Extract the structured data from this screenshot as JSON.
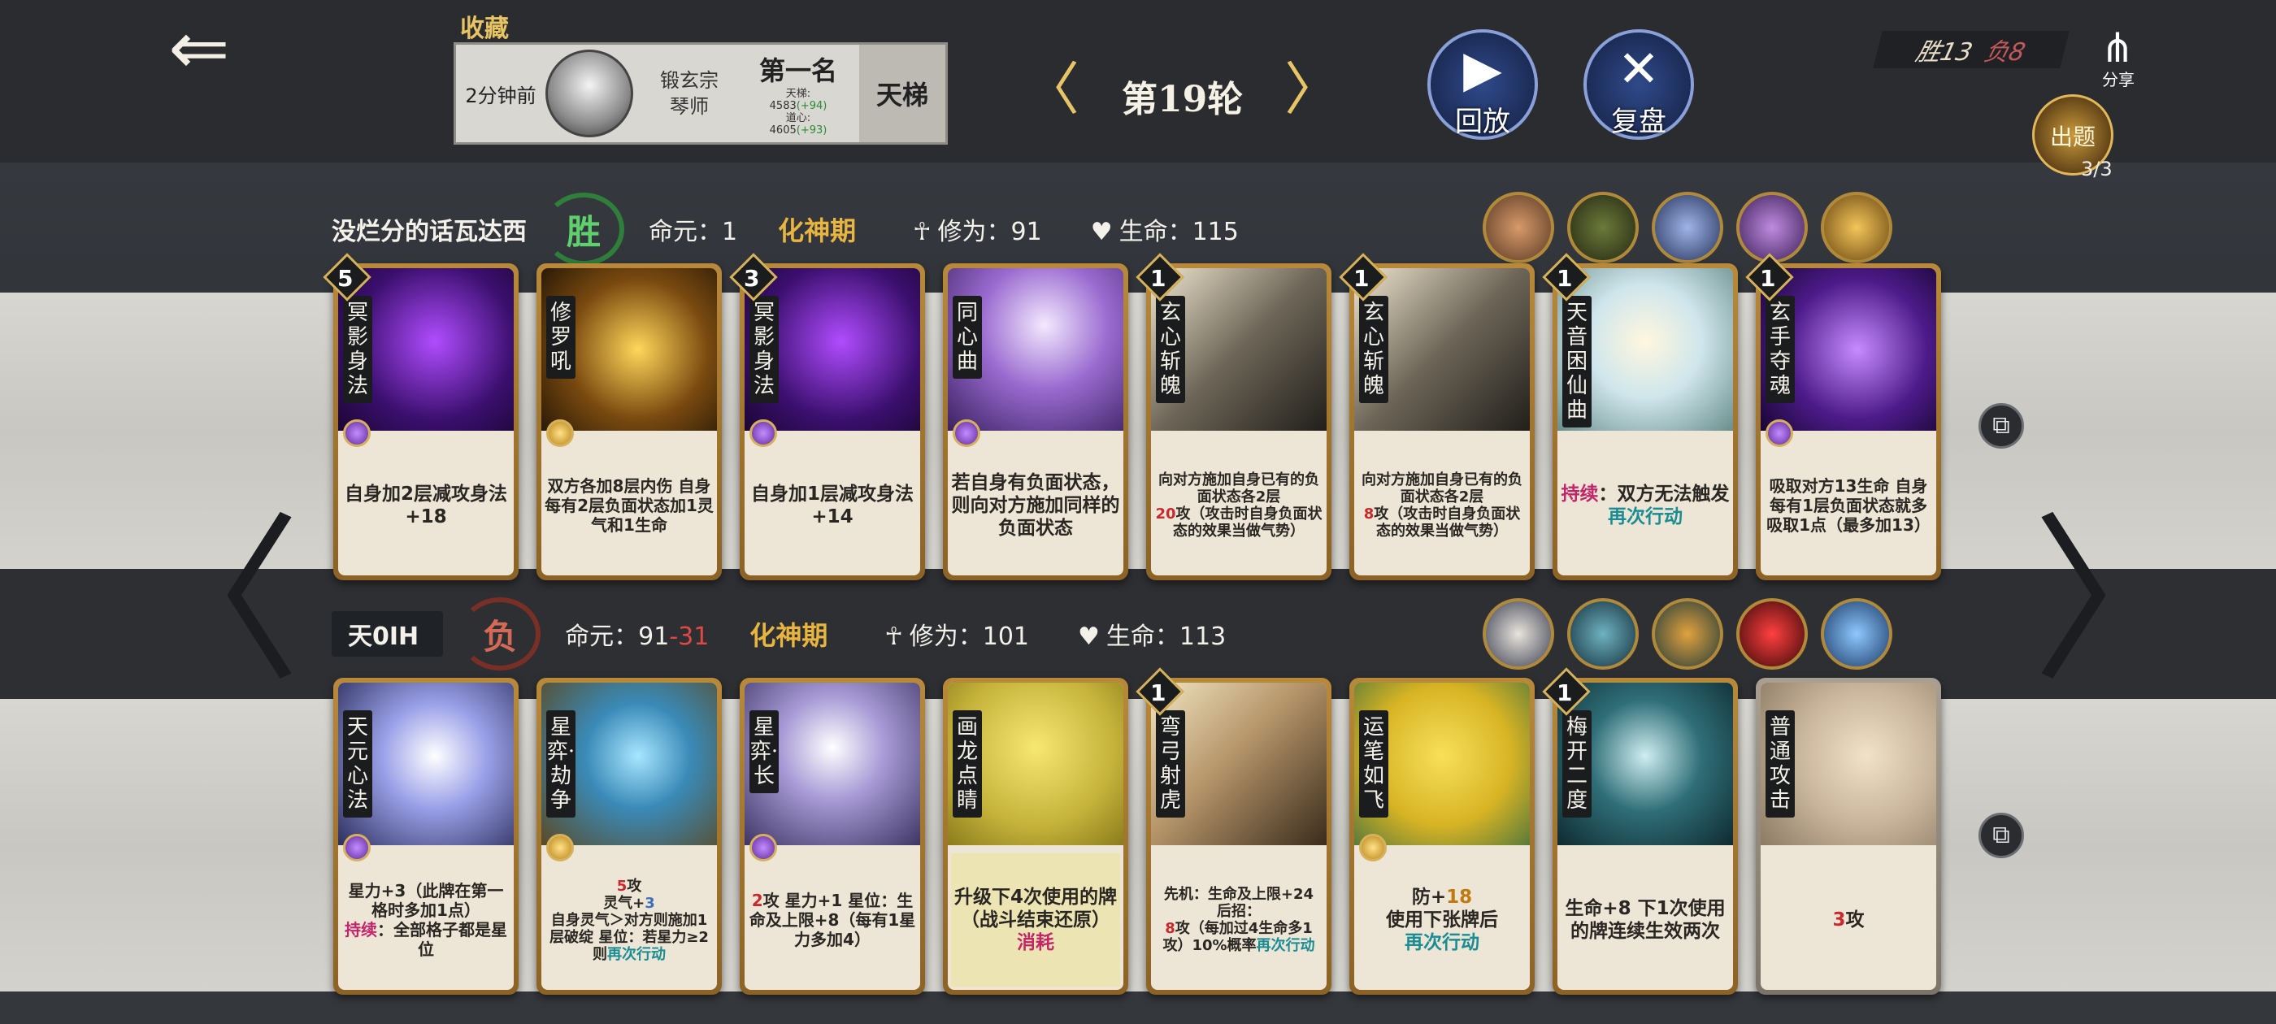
{
  "header": {
    "collect_label": "收藏",
    "record": {
      "time": "2分钟前",
      "sect_line1": "锻玄宗",
      "sect_line2": "琴师",
      "rank": "第一名",
      "stat1": "天梯:",
      "stat1_val": "4583",
      "stat1_delta": "(+94)",
      "stat2": "道心:",
      "stat2_val": "4605",
      "stat2_delta": "(+93)",
      "mode": "天梯"
    },
    "round_title": "第19轮",
    "round_prev": "〈",
    "round_next": "〉",
    "replay_label": "回放",
    "review_label": "复盘",
    "score_win": "胜13",
    "score_lose": "负8",
    "share_label": "分享",
    "puzzle_label": "出题",
    "puzzle_count": "3/3"
  },
  "player1": {
    "name": "没烂分的话瓦达西",
    "result": "胜",
    "destiny": "命元：1",
    "realm": "化神期",
    "cultivation": "修为：91",
    "health": "生命：115"
  },
  "player2": {
    "name": "天0IH",
    "result": "负",
    "destiny_prefix": "命元：91",
    "destiny_minus": "-31",
    "realm": "化神期",
    "cultivation": "修为：101",
    "health": "生命：113"
  },
  "colors": {
    "accent_gold": "#e8b640",
    "win_green": "#5fd06d",
    "lose_red": "#d46a56"
  },
  "cards_row1": [
    {
      "level": "5",
      "name": "冥影身法",
      "gem": "purple",
      "desc": "自身加2层减攻身法+18"
    },
    {
      "level": "",
      "name": "修罗吼",
      "gem": "gold",
      "desc": "双方各加8层内伤 自身每有2层负面状态加1灵气和1生命"
    },
    {
      "level": "3",
      "name": "冥影身法",
      "gem": "purple",
      "desc": "自身加1层减攻身法+14"
    },
    {
      "level": "",
      "name": "同心曲",
      "gem": "purple",
      "desc": "若自身有负面状态，则向对方施加同样的负面状态"
    },
    {
      "level": "1",
      "name": "玄心斩魄",
      "gem": "",
      "desc_a": "向对方施加自身已有的负面状态各2层",
      "desc_num": "20",
      "desc_b": "攻（攻击时自身负面状态的效果当做气势）"
    },
    {
      "level": "1",
      "name": "玄心斩魄",
      "gem": "",
      "desc_a": "向对方施加自身已有的负面状态各2层",
      "desc_num": "8",
      "desc_b": "攻（攻击时自身负面状态的效果当做气势）"
    },
    {
      "level": "1",
      "name": "天音困仙曲",
      "gem": "",
      "desc_kw": "持续",
      "desc_a": "：双方无法触发",
      "desc_kw2": "再次行动"
    },
    {
      "level": "1",
      "name": "玄手夺魂",
      "gem": "purple",
      "desc": "吸取对方13生命 自身每有1层负面状态就多吸取1点（最多加13）"
    }
  ],
  "cards_row2": [
    {
      "level": "",
      "name": "天元心法",
      "gem": "purple",
      "desc_a": "星力+3（此牌在第一格时多加1点）",
      "desc_kw": "持续",
      "desc_b": "：全部格子都是星位"
    },
    {
      "level": "",
      "name": "星弈·劫争",
      "gem": "gold",
      "desc_num": "5",
      "desc_a": "攻",
      "desc_b": "灵气+",
      "desc_num2": "3",
      "desc_c": "自身灵气＞对方则施加1层破绽 星位：若星力≥2则",
      "desc_kw": "再次行动"
    },
    {
      "level": "",
      "name": "星弈·长",
      "gem": "purple",
      "desc_num": "2",
      "desc_a": "攻 星力+1 星位：生命及上限+8（每有1星力多加4）"
    },
    {
      "level": "",
      "name": "画龙点睛",
      "gem": "",
      "desc_a": "升级下4次使用的牌（战斗结束还原）",
      "desc_kw": "消耗"
    },
    {
      "level": "1",
      "name": "弯弓射虎",
      "gem": "",
      "desc_a": "先机：生命及上限+24 后招：",
      "desc_num": "8",
      "desc_b": "攻（每加过4生命多1攻）10%概率",
      "desc_kw": "再次行动"
    },
    {
      "level": "",
      "name": "运笔如飞",
      "gem": "gold",
      "desc_a": "防+",
      "desc_num": "18",
      "desc_b": "使用下张牌后",
      "desc_kw": "再次行动"
    },
    {
      "level": "1",
      "name": "梅开二度",
      "gem": "",
      "desc": "生命+8 下1次使用的牌连续生效两次"
    },
    {
      "level": "",
      "name": "普通攻击",
      "gem": "",
      "desc_num": "3",
      "desc_a": "攻"
    }
  ]
}
